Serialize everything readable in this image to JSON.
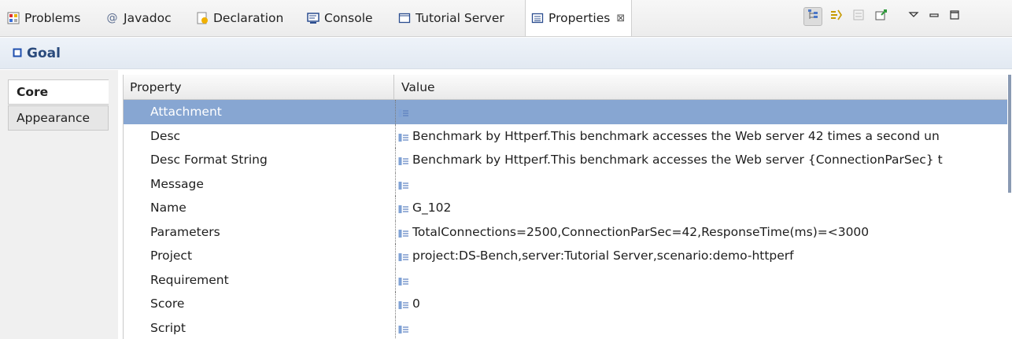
{
  "tabs": [
    {
      "label": "Problems",
      "icon": "problems-icon"
    },
    {
      "label": "Javadoc",
      "icon": "at-icon"
    },
    {
      "label": "Declaration",
      "icon": "declaration-icon"
    },
    {
      "label": "Console",
      "icon": "console-icon"
    },
    {
      "label": "Tutorial Server",
      "icon": "window-icon"
    },
    {
      "label": "Properties",
      "icon": "properties-icon",
      "active": true
    }
  ],
  "tab_close": "⊠",
  "title": "Goal",
  "side_tabs": [
    {
      "label": "Core",
      "active": true
    },
    {
      "label": "Appearance",
      "active": false
    }
  ],
  "table": {
    "headers": [
      "Property",
      "Value"
    ],
    "rows": [
      {
        "property": "Attachment",
        "value": "",
        "selected": true
      },
      {
        "property": "Desc",
        "value": "Benchmark by Httperf.This benchmark accesses the Web server 42 times a second un"
      },
      {
        "property": "Desc Format String",
        "value": "Benchmark by Httperf.This benchmark accesses the Web server {ConnectionParSec} t"
      },
      {
        "property": "Message",
        "value": ""
      },
      {
        "property": "Name",
        "value": "G_102"
      },
      {
        "property": "Parameters",
        "value": "TotalConnections=2500,ConnectionParSec=42,ResponseTime(ms)=<3000"
      },
      {
        "property": "Project",
        "value": "project:DS-Bench,server:Tutorial Server,scenario:demo-httperf"
      },
      {
        "property": "Requirement",
        "value": ""
      },
      {
        "property": "Score",
        "value": "0"
      },
      {
        "property": "Script",
        "value": ""
      }
    ]
  },
  "colors": {
    "selection": "#87a6d2",
    "title_text": "#2a4a7c"
  }
}
